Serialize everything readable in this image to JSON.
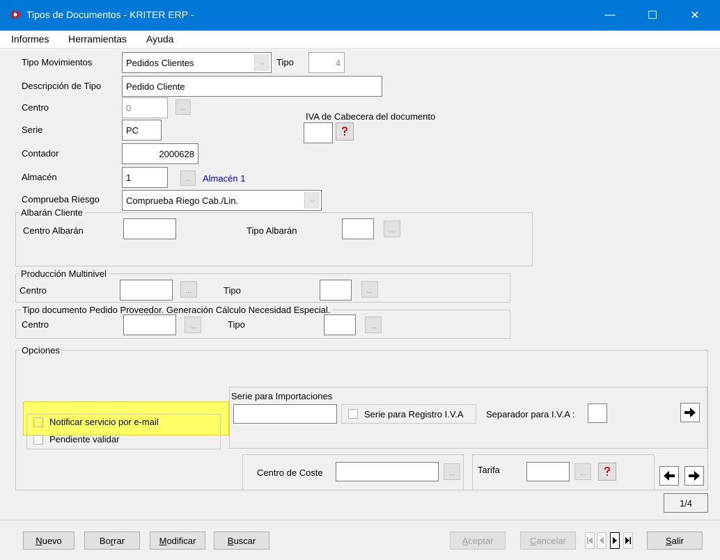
{
  "window": {
    "title": "Tipos de Documentos - KRITER ERP - ",
    "minimize": "—",
    "maximize": "☐",
    "close": "✕"
  },
  "menu": [
    "Informes",
    "Herramientas",
    "Ayuda"
  ],
  "form": {
    "tipo_movimientos_label": "Tipo Movimientos",
    "tipo_movimientos_value": "Pedidos Clientes",
    "tipo_label": "Tipo",
    "tipo_value": "4",
    "descripcion_label": "Descripción de Tipo",
    "descripcion_value": "Pedido Cliente",
    "centro_label": "Centro",
    "centro_value": "0",
    "iva_label": "IVA de Cabecera del documento",
    "serie_label": "Serie",
    "serie_value": "PC",
    "contador_label": "Contador",
    "contador_value": "2000628",
    "almacen_label": "Almacén",
    "almacen_value": "1",
    "almacen_name": "Almacén 1",
    "comprueba_label": "Comprueba Riesgo",
    "comprueba_value": "Comprueba Riego Cab./Lin."
  },
  "albaran": {
    "title": "Albarán Cliente",
    "centro_label": "Centro Albarán",
    "tipo_label": "Tipo Albarán"
  },
  "produccion": {
    "title": "Producción Multinivel",
    "centro_label": "Centro",
    "tipo_label": "Tipo"
  },
  "pedido_proveedor": {
    "title": "Tipo documento Pedido Proveedor. Generación Cálculo Necesidad Especial.",
    "centro_label": "Centro",
    "tipo_label": "Tipo"
  },
  "opciones": {
    "title": "Opciones",
    "notificar_label": "Notificar servicio por e-mail",
    "pendiente_label": "Pendiente validar",
    "serie_importaciones_label": "Serie para Importaciones",
    "serie_registro_label": "Serie para Registro I.V.A",
    "separador_label": "Separador para I.V.A :",
    "centro_coste_label": "Centro de Coste",
    "tarifa_label": "Tarifa"
  },
  "pager": {
    "text": "1/4"
  },
  "buttons": {
    "nuevo": {
      "u": "N",
      "rest": "uevo"
    },
    "borrar_pre": "Bo",
    "borrar_u": "r",
    "borrar_post": "rar",
    "modificar": {
      "u": "M",
      "rest": "odificar"
    },
    "buscar": {
      "u": "B",
      "rest": "uscar"
    },
    "aceptar": {
      "u": "A",
      "rest": "ceptar"
    },
    "cancelar": {
      "u": "C",
      "rest": "ancelar"
    },
    "salir": {
      "u": "S",
      "rest": "alir"
    }
  },
  "icons": {
    "dots": "...",
    "combo": "⌵",
    "question_color": "#cc1111",
    "highlight_color": "#ffff66"
  }
}
